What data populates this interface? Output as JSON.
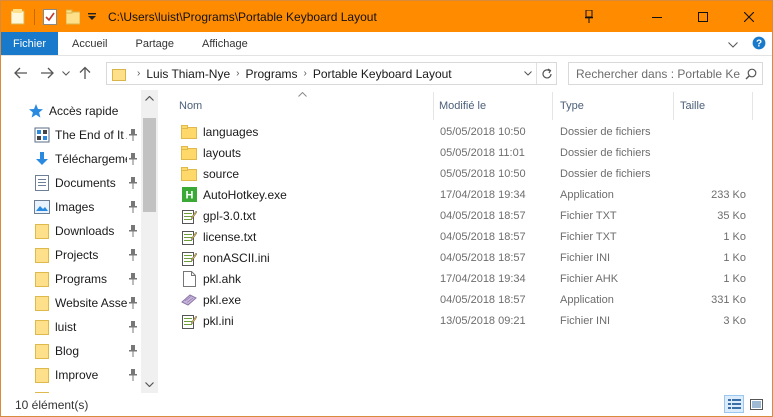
{
  "window": {
    "title": "C:\\Users\\luist\\Programs\\Portable Keyboard Layout",
    "accent": "#ff8c00"
  },
  "ribbon": {
    "tabs": [
      "Fichier",
      "Accueil",
      "Partage",
      "Affichage"
    ],
    "file_color": "#1979ca"
  },
  "address": {
    "crumbs": [
      "Luis Thiam-Nye",
      "Programs",
      "Portable Keyboard Layout"
    ]
  },
  "search": {
    "placeholder": "Rechercher dans : Portable Ke..."
  },
  "sidebar": {
    "quick_access": "Accès rapide",
    "items": [
      {
        "label": "The End of It A",
        "icon": "document-app-icon",
        "pinned": true
      },
      {
        "label": "Téléchargeme",
        "icon": "download-arrow-icon",
        "pinned": true
      },
      {
        "label": "Documents",
        "icon": "documents-icon",
        "pinned": true
      },
      {
        "label": "Images",
        "icon": "images-icon",
        "pinned": true
      },
      {
        "label": "Downloads",
        "icon": "folder-icon",
        "pinned": true
      },
      {
        "label": "Projects",
        "icon": "folder-icon",
        "pinned": true
      },
      {
        "label": "Programs",
        "icon": "folder-icon",
        "pinned": true
      },
      {
        "label": "Website Asse",
        "icon": "folder-icon",
        "pinned": true
      },
      {
        "label": "luist",
        "icon": "folder-icon",
        "pinned": true
      },
      {
        "label": "Blog",
        "icon": "folder-icon",
        "pinned": true
      },
      {
        "label": "Improve",
        "icon": "folder-icon",
        "pinned": true
      }
    ]
  },
  "files": {
    "columns": [
      "Nom",
      "Modifié le",
      "Type",
      "Taille"
    ],
    "rows": [
      {
        "name": "languages",
        "modified": "05/05/2018 10:50",
        "type": "Dossier de fichiers",
        "size": "",
        "icon": "folder-icon"
      },
      {
        "name": "layouts",
        "modified": "05/05/2018 11:01",
        "type": "Dossier de fichiers",
        "size": "",
        "icon": "folder-icon"
      },
      {
        "name": "source",
        "modified": "05/05/2018 10:50",
        "type": "Dossier de fichiers",
        "size": "",
        "icon": "folder-icon"
      },
      {
        "name": "AutoHotkey.exe",
        "modified": "17/04/2018 19:34",
        "type": "Application",
        "size": "233 Ko",
        "icon": "autohotkey-icon"
      },
      {
        "name": "gpl-3.0.txt",
        "modified": "04/05/2018 18:57",
        "type": "Fichier TXT",
        "size": "35 Ko",
        "icon": "notepad-icon"
      },
      {
        "name": "license.txt",
        "modified": "04/05/2018 18:57",
        "type": "Fichier TXT",
        "size": "1 Ko",
        "icon": "notepad-icon"
      },
      {
        "name": "nonASCII.ini",
        "modified": "04/05/2018 18:57",
        "type": "Fichier INI",
        "size": "1 Ko",
        "icon": "ini-file-icon"
      },
      {
        "name": "pkl.ahk",
        "modified": "17/04/2018 19:34",
        "type": "Fichier AHK",
        "size": "1 Ko",
        "icon": "blank-file-icon"
      },
      {
        "name": "pkl.exe",
        "modified": "04/05/2018 18:57",
        "type": "Application",
        "size": "331 Ko",
        "icon": "keyboard-app-icon"
      },
      {
        "name": "pkl.ini",
        "modified": "13/05/2018 09:21",
        "type": "Fichier INI",
        "size": "3 Ko",
        "icon": "ini-file-icon"
      }
    ]
  },
  "status": {
    "count": "10 élément(s)"
  }
}
